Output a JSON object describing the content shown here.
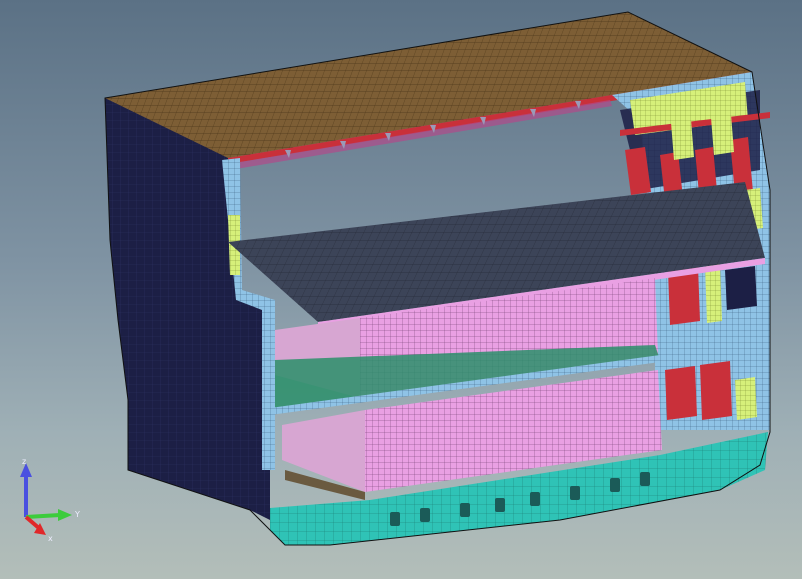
{
  "viewport": {
    "background_top": "#5b7185",
    "background_bottom": "#b3beb9"
  },
  "model": {
    "colors": {
      "deck": "#7d5e35",
      "hull_side": "#1c1f45",
      "frame": "#8fc3e6",
      "cargo": "#e9a0e3",
      "bottom": "#2fc3b6",
      "bracket": "#c9303a",
      "stiffener": "#d6f07a",
      "tank_top": "#3c4458"
    }
  },
  "triad": {
    "x_label": "x",
    "y_label": "Y",
    "z_label": "z",
    "x_color": "#e0282a",
    "y_color": "#3ccc3c",
    "z_color": "#4a50e0"
  }
}
